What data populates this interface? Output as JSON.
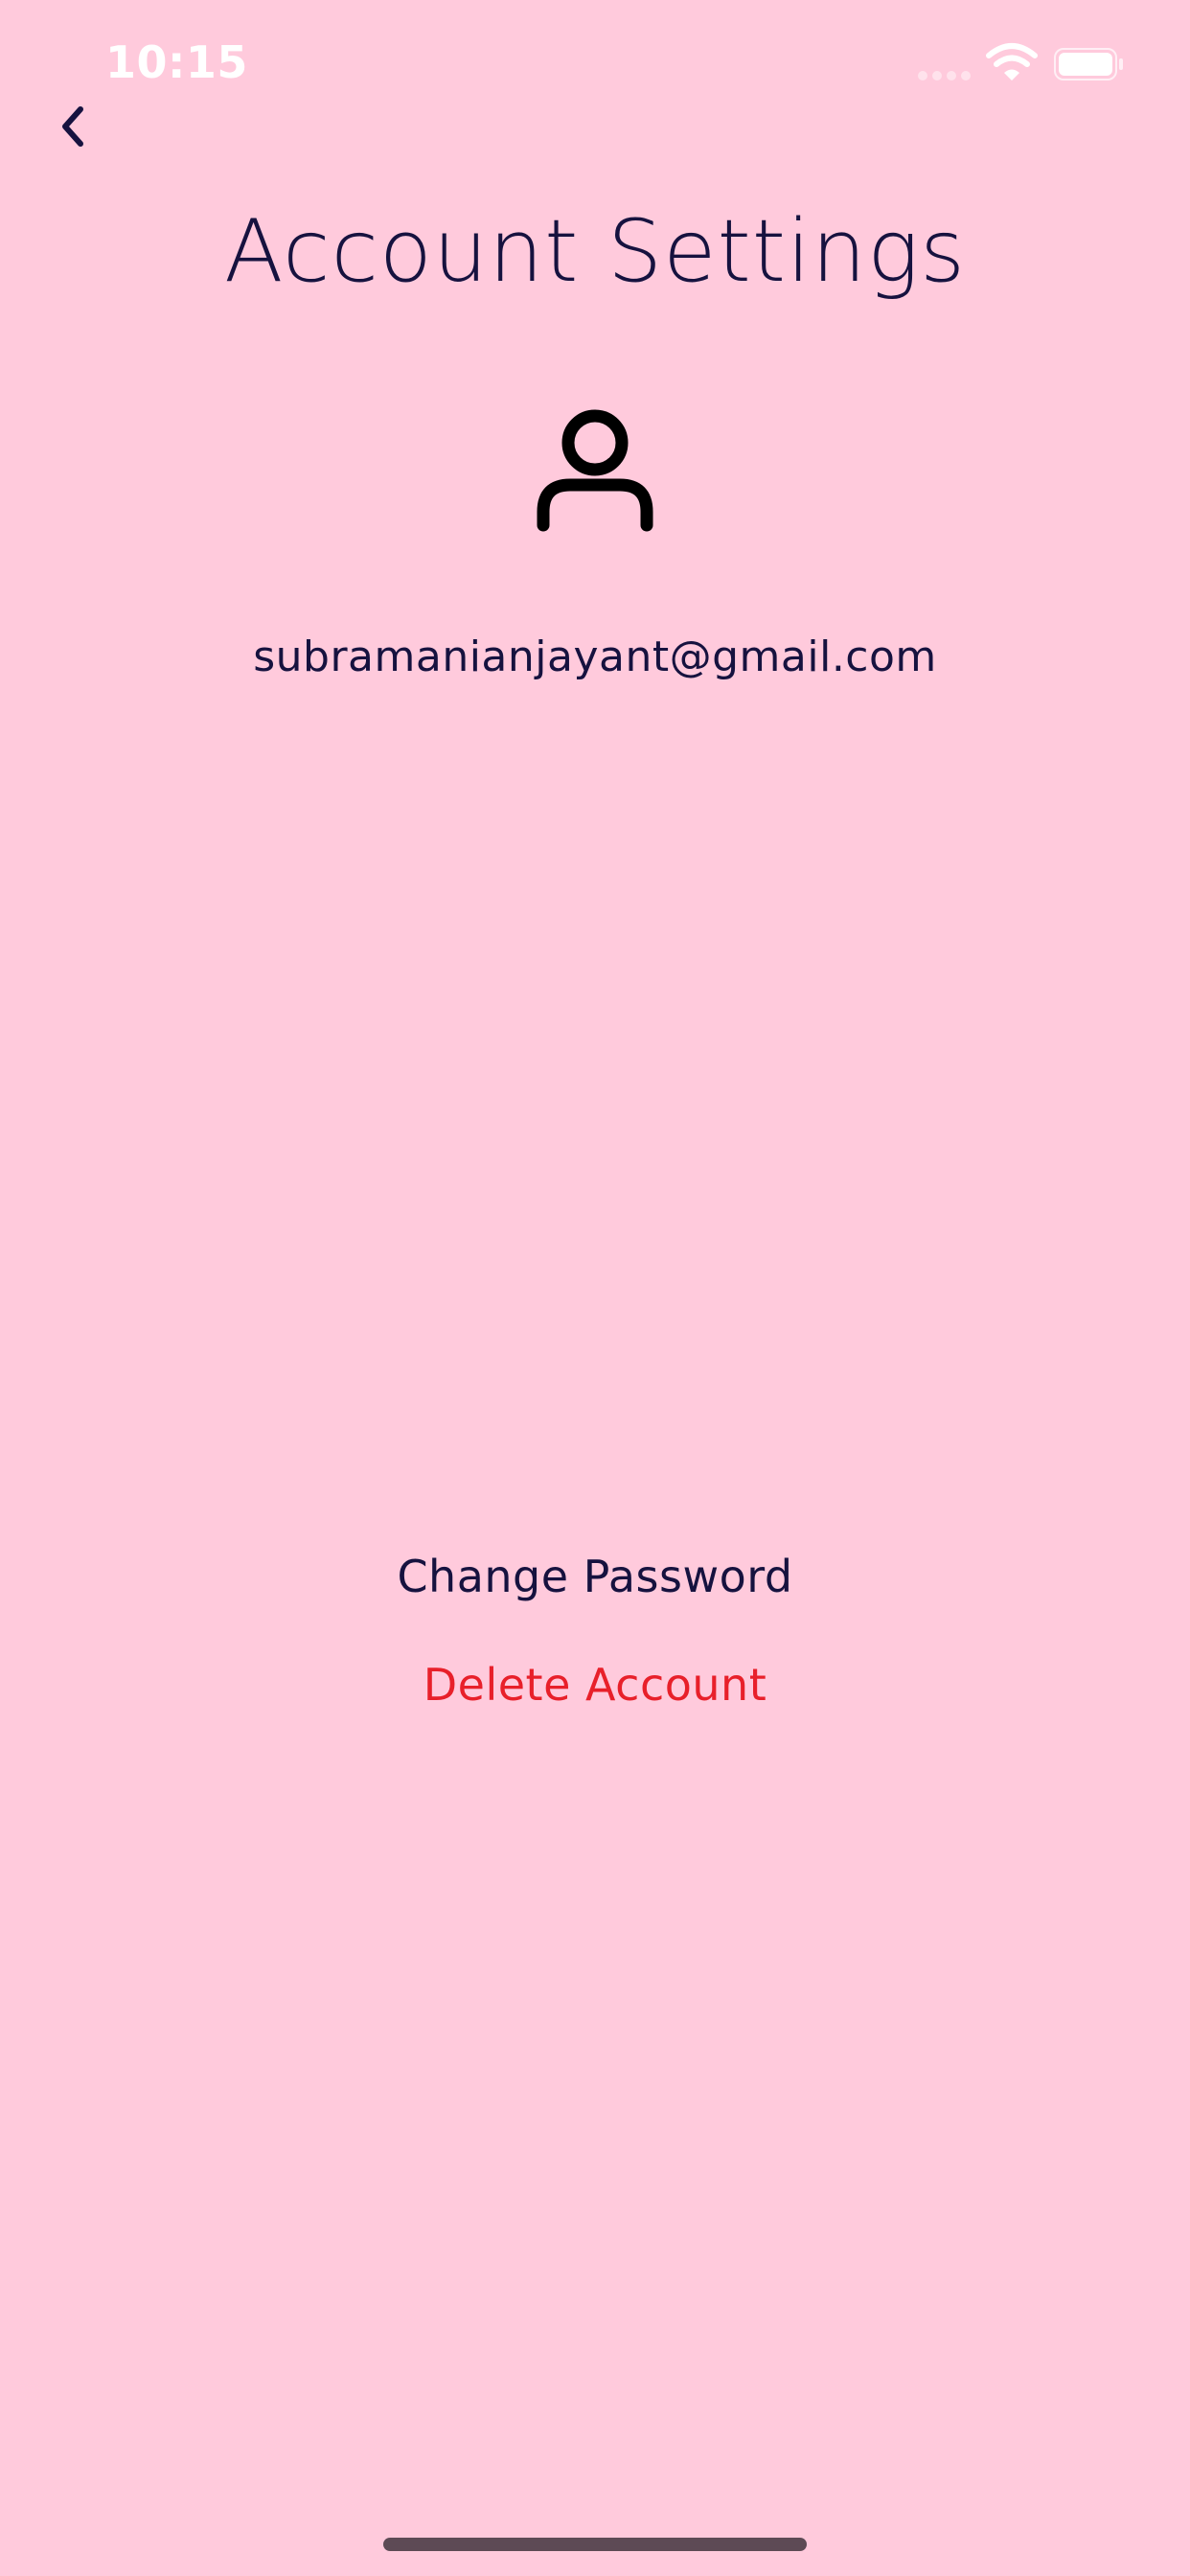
{
  "status_bar": {
    "time": "10:15"
  },
  "header": {
    "title": "Account Settings",
    "back_icon": "chevron-left-icon"
  },
  "profile": {
    "avatar_icon": "user-icon",
    "email": "subramanianjayant@gmail.com"
  },
  "actions": {
    "change_password": "Change Password",
    "delete_account": "Delete Account"
  },
  "colors": {
    "background": "#ffcadc",
    "text": "#16123f",
    "danger": "#e8202a"
  }
}
